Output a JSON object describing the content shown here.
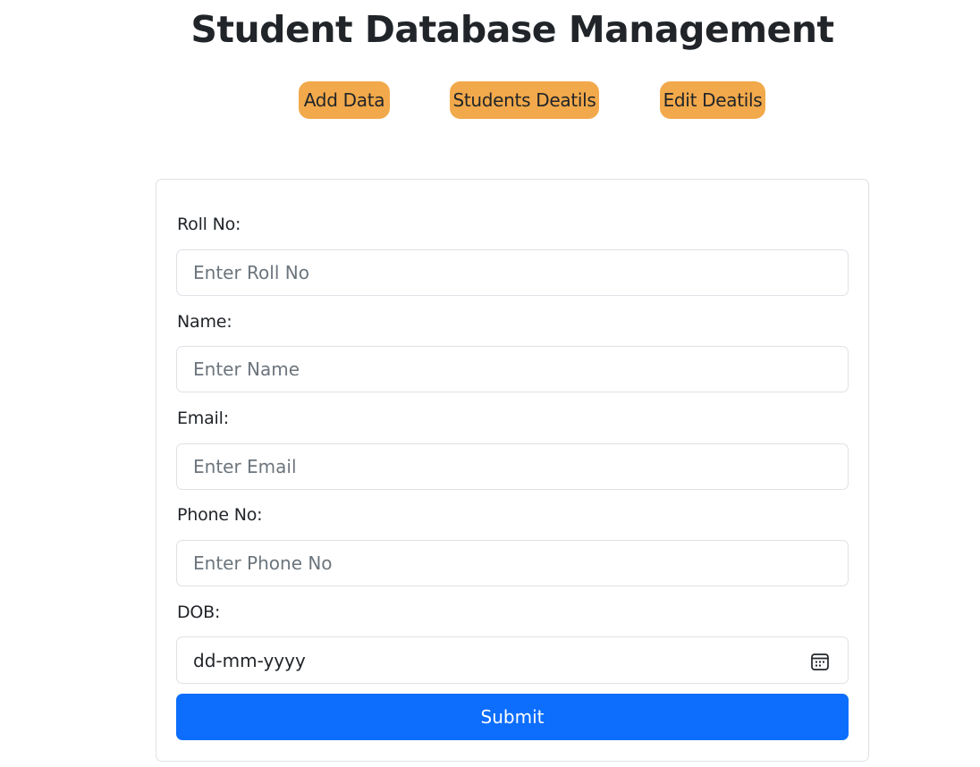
{
  "header": {
    "title": "Student Database Management"
  },
  "nav": {
    "add_data": "Add Data",
    "students_details": "Students Deatils",
    "edit_details": "Edit Deatils",
    "button_color": "#f2a94b"
  },
  "form": {
    "roll_no": {
      "label": "Roll No:",
      "placeholder": "Enter Roll No",
      "value": ""
    },
    "name": {
      "label": "Name:",
      "placeholder": "Enter Name",
      "value": ""
    },
    "email": {
      "label": "Email:",
      "placeholder": "Enter Email",
      "value": ""
    },
    "phone": {
      "label": "Phone No:",
      "placeholder": "Enter Phone No",
      "value": ""
    },
    "dob": {
      "label": "DOB:",
      "placeholder": "dd-mm-yyyy",
      "icon": "calendar-icon"
    },
    "submit_label": "Submit",
    "submit_color": "#0d6efd"
  }
}
